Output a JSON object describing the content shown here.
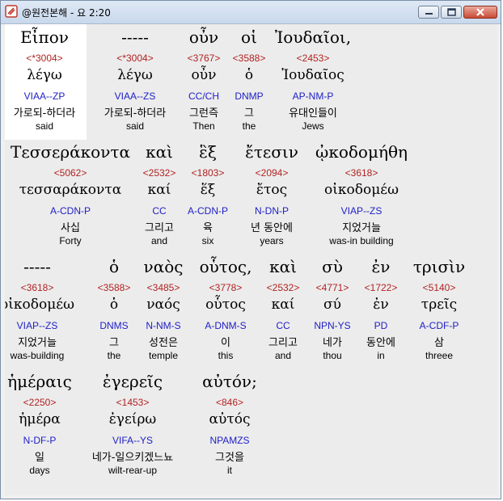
{
  "window": {
    "title": "@원전본해 - 요 2:20",
    "controls": {
      "minimize": "minimize-icon",
      "maximize": "maximize-icon",
      "close": "close-icon"
    }
  },
  "rows": [
    [
      {
        "greek": "Εἶπον",
        "strong": "<*3004>",
        "lemma": "λέγω",
        "morph": "VIAA--ZP",
        "korean": "가로되-하더라",
        "english": "said",
        "highlight": true
      },
      {
        "greek": "-----",
        "strong": "<*3004>",
        "lemma": "λέγω",
        "morph": "VIAA--ZS",
        "korean": "가로되-하더라",
        "english": "said"
      },
      {
        "greek": "οὖν",
        "strong": "<3767>",
        "lemma": "οὖν",
        "morph": "CC/CH",
        "korean": "그런즉",
        "english": "Then"
      },
      {
        "greek": "οἱ",
        "strong": "<3588>",
        "lemma": "ὁ",
        "morph": "DNMP",
        "korean": "그",
        "english": "the"
      },
      {
        "greek": "Ἰουδαῖοι,",
        "strong": "<2453>",
        "lemma": "Ἰουδαῖος",
        "morph": "AP-NM-P",
        "korean": "유대인들이",
        "english": "Jews"
      }
    ],
    [
      {
        "greek": "Τεσσεράκοντα",
        "strong": "<5062>",
        "lemma": "τεσσαράκοντα",
        "morph": "A-CDN-P",
        "korean": "사십",
        "english": "Forty"
      },
      {
        "greek": "καὶ",
        "strong": "<2532>",
        "lemma": "καί",
        "morph": "CC",
        "korean": "그리고",
        "english": "and"
      },
      {
        "greek": "ἓξ",
        "strong": "<1803>",
        "lemma": "ἕξ",
        "morph": "A-CDN-P",
        "korean": "육",
        "english": "six"
      },
      {
        "greek": "ἔτεσιν",
        "strong": "<2094>",
        "lemma": "ἔτος",
        "morph": "N-DN-P",
        "korean": "년 동안에",
        "english": "years"
      },
      {
        "greek": "ᾠκοδομήθη",
        "strong": "<3618>",
        "lemma": "οἰκοδομέω",
        "morph": "VIAP--ZS",
        "korean": "지었거늘",
        "english": "was-in building"
      }
    ],
    [
      {
        "greek": "-----",
        "strong": "<3618>",
        "lemma": "οἰκοδομέω",
        "morph": "VIAP--ZS",
        "korean": "지었거늘",
        "english": "was-building"
      },
      {
        "greek": "ὁ",
        "strong": "<3588>",
        "lemma": "ὁ",
        "morph": "DNMS",
        "korean": "그",
        "english": "the"
      },
      {
        "greek": "ναὸς",
        "strong": "<3485>",
        "lemma": "ναός",
        "morph": "N-NM-S",
        "korean": "성전은",
        "english": "temple"
      },
      {
        "greek": "οὗτος,",
        "strong": "<3778>",
        "lemma": "οὗτος",
        "morph": "A-DNM-S",
        "korean": "이",
        "english": "this"
      },
      {
        "greek": "καὶ",
        "strong": "<2532>",
        "lemma": "καί",
        "morph": "CC",
        "korean": "그리고",
        "english": "and"
      },
      {
        "greek": "σὺ",
        "strong": "<4771>",
        "lemma": "σύ",
        "morph": "NPN-YS",
        "korean": "네가",
        "english": "thou"
      },
      {
        "greek": "ἐν",
        "strong": "<1722>",
        "lemma": "ἐν",
        "morph": "PD",
        "korean": "동안에",
        "english": "in"
      },
      {
        "greek": "τρισὶν",
        "strong": "<5140>",
        "lemma": "τρεῖς",
        "morph": "A-CDF-P",
        "korean": "삼",
        "english": "threee"
      }
    ],
    [
      {
        "greek": "ἡμέραις",
        "strong": "<2250>",
        "lemma": "ἡμέρα",
        "morph": "N-DF-P",
        "korean": "일",
        "english": "days"
      },
      {
        "greek": "ἐγερεῖς",
        "strong": "<1453>",
        "lemma": "ἐγείρω",
        "morph": "VIFA--YS",
        "korean": "네가-일으키겠느뇨",
        "english": "wilt-rear-up"
      },
      {
        "greek": "αὐτόν;",
        "strong": "<846>",
        "lemma": "αὐτός",
        "morph": "NPAMZS",
        "korean": "그것을",
        "english": "it"
      }
    ]
  ]
}
